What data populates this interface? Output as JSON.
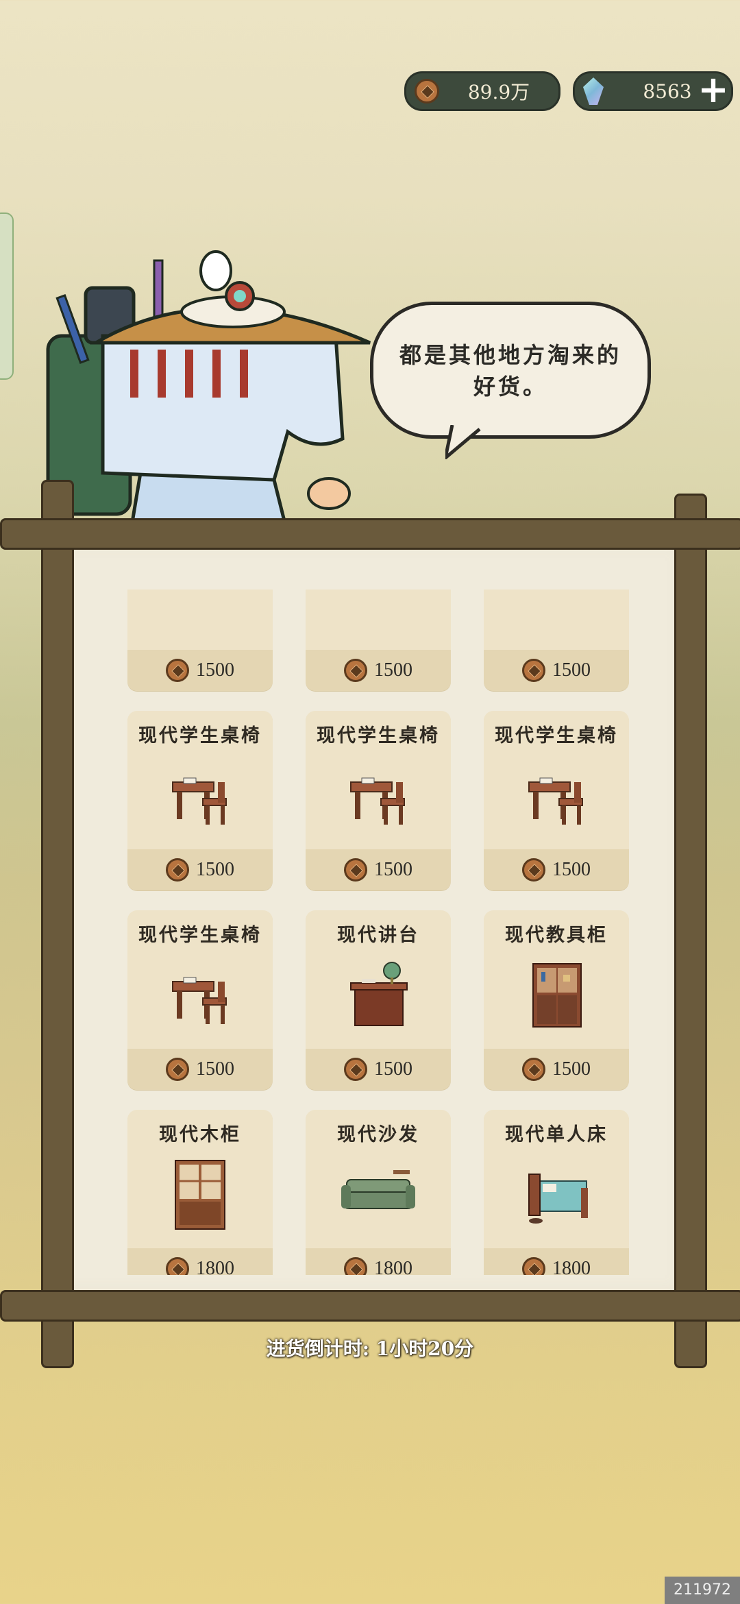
{
  "currency": {
    "coins": "89.9万",
    "gems": "8563",
    "add_label": "+"
  },
  "npc": {
    "speech": "都是其他地方淘来的好货。",
    "speech_line1": "都是其他地方淘来的",
    "speech_line2": "好货。"
  },
  "shop": {
    "items": [
      {
        "name": "",
        "price": "1500",
        "icon": "desk-icon"
      },
      {
        "name": "",
        "price": "1500",
        "icon": "box-icon"
      },
      {
        "name": "",
        "price": "1500",
        "icon": "desk-icon"
      },
      {
        "name": "现代学生桌椅",
        "price": "1500",
        "icon": "student-desk-icon"
      },
      {
        "name": "现代学生桌椅",
        "price": "1500",
        "icon": "student-desk-icon"
      },
      {
        "name": "现代学生桌椅",
        "price": "1500",
        "icon": "student-desk-icon"
      },
      {
        "name": "现代学生桌椅",
        "price": "1500",
        "icon": "student-desk-icon"
      },
      {
        "name": "现代讲台",
        "price": "1500",
        "icon": "lectern-icon"
      },
      {
        "name": "现代教具柜",
        "price": "1500",
        "icon": "cabinet-icon"
      },
      {
        "name": "现代木柜",
        "price": "1800",
        "icon": "wardrobe-icon"
      },
      {
        "name": "现代沙发",
        "price": "1800",
        "icon": "sofa-icon"
      },
      {
        "name": "现代单人床",
        "price": "1800",
        "icon": "bed-icon"
      }
    ]
  },
  "countdown": "进货倒计时: 1小时20分",
  "watermark": "211972",
  "colors": {
    "board": "#f0ebdc",
    "card": "#eee3c8",
    "wood": "#6a5a3c",
    "pill": "#3d4a3c"
  }
}
